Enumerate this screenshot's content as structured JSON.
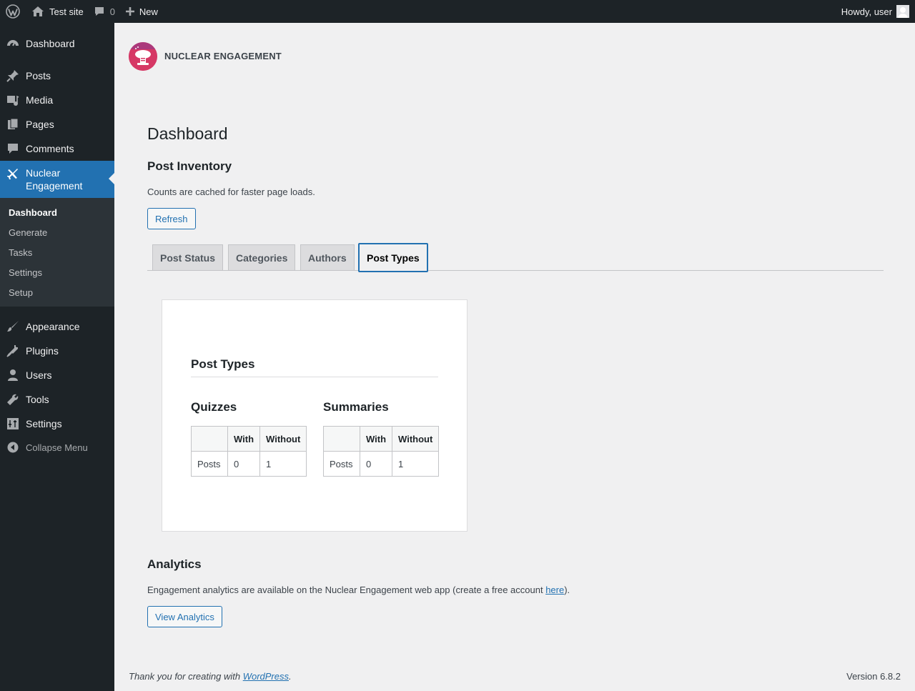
{
  "adminbar": {
    "site_name": "Test site",
    "comments_count": "0",
    "new_label": "New",
    "greeting": "Howdy, user"
  },
  "sidebar": {
    "items": [
      {
        "label": "Dashboard",
        "icon": "dashboard-icon"
      },
      {
        "label": "Posts",
        "icon": "pin-icon"
      },
      {
        "label": "Media",
        "icon": "media-icon"
      },
      {
        "label": "Pages",
        "icon": "pages-icon"
      },
      {
        "label": "Comments",
        "icon": "comment-icon"
      },
      {
        "label": "Nuclear Engagement",
        "icon": "plane-icon"
      },
      {
        "label": "Appearance",
        "icon": "brush-icon"
      },
      {
        "label": "Plugins",
        "icon": "plug-icon"
      },
      {
        "label": "Users",
        "icon": "user-icon"
      },
      {
        "label": "Tools",
        "icon": "wrench-icon"
      },
      {
        "label": "Settings",
        "icon": "sliders-icon"
      }
    ],
    "submenu": [
      "Dashboard",
      "Generate",
      "Tasks",
      "Settings",
      "Setup"
    ],
    "collapse_label": "Collapse Menu"
  },
  "plugin": {
    "name": "NUCLEAR ENGAGEMENT"
  },
  "page": {
    "title": "Dashboard",
    "inventory_heading": "Post Inventory",
    "cache_note": "Counts are cached for faster page loads.",
    "refresh_label": "Refresh",
    "tabs": [
      "Post Status",
      "Categories",
      "Authors",
      "Post Types"
    ],
    "active_tab": "Post Types"
  },
  "card": {
    "title": "Post Types",
    "groups": [
      {
        "title": "Quizzes",
        "columns": [
          "",
          "With",
          "Without"
        ],
        "rows": [
          [
            "Posts",
            "0",
            "1"
          ]
        ]
      },
      {
        "title": "Summaries",
        "columns": [
          "",
          "With",
          "Without"
        ],
        "rows": [
          [
            "Posts",
            "0",
            "1"
          ]
        ]
      }
    ]
  },
  "analytics": {
    "heading": "Analytics",
    "text_before": "Engagement analytics are available on the Nuclear Engagement web app (create a free account ",
    "link_text": "here",
    "text_after": ").",
    "button_label": "View Analytics"
  },
  "footer": {
    "thanks_before": "Thank you for creating with ",
    "thanks_link": "WordPress",
    "thanks_after": ".",
    "version": "Version 6.8.2"
  },
  "colors": {
    "accent": "#2271b1",
    "adminbar_bg": "#1d2327",
    "page_bg": "#f0f0f1",
    "plugin_logo": "#d63865"
  }
}
